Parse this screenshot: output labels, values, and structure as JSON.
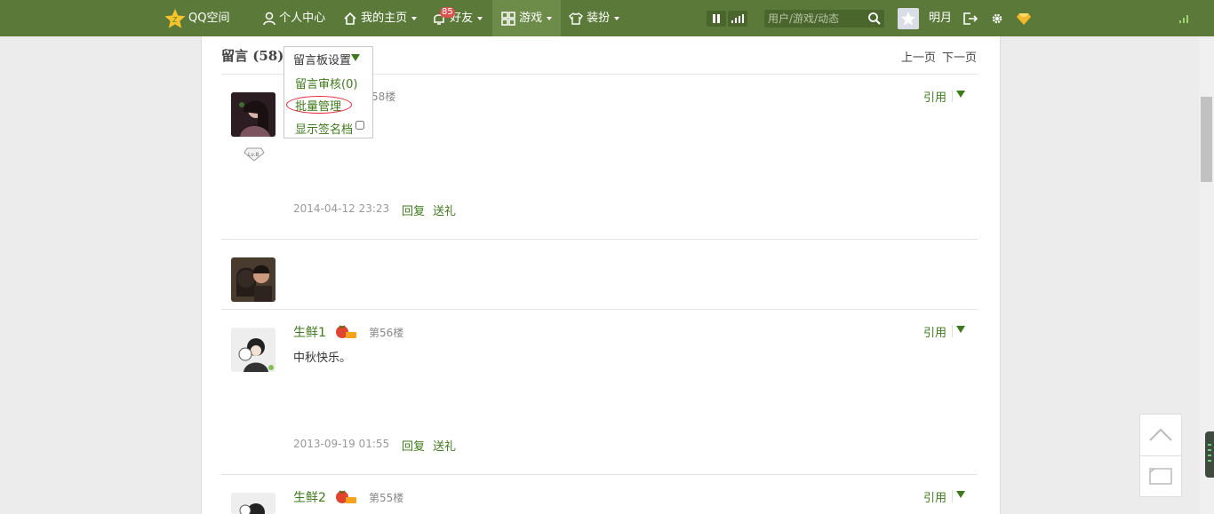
{
  "topbar": {
    "logo": "QQ空间",
    "nav": {
      "profile_center": "个人中心",
      "my_home": "我的主页",
      "friends": "好友",
      "friends_badge": "85",
      "games": "游戏",
      "dressup": "装扮"
    },
    "search_placeholder": "用户/游戏/动态",
    "username": "明月",
    "colors": {
      "bar": "#5b7a3a",
      "active": "#6e8c49"
    }
  },
  "message_board": {
    "title": "留言 (58)",
    "prev_page": "上一页",
    "next_page": "下一页",
    "settings_menu": {
      "label": "留言板设置",
      "items": [
        "留言审核(0)",
        "批量管理",
        "显示签名档"
      ]
    }
  },
  "entries": [
    {
      "floor": "58楼",
      "time": "2014-04-12 23:23",
      "reply": "回复",
      "gift": "送礼",
      "quote": "引用"
    },
    {},
    {
      "name": "生鲜1",
      "floor": "第56楼",
      "content": "中秋快乐。",
      "time": "2013-09-19 01:55",
      "reply": "回复",
      "gift": "送礼",
      "quote": "引用"
    },
    {
      "name": "生鲜2",
      "floor": "第55楼",
      "quote": "引用"
    }
  ],
  "accent_color": "#3d7a19"
}
